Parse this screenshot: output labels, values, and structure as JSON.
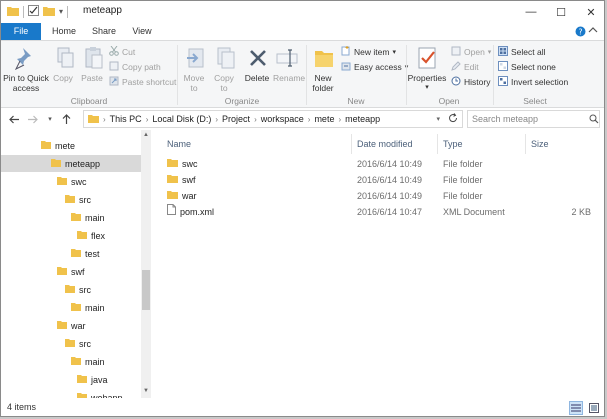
{
  "window": {
    "title": "meteapp",
    "minimize_glyph": "—",
    "maximize_glyph": "☐",
    "close_glyph": "✕"
  },
  "tabs": [
    {
      "label": "File"
    },
    {
      "label": "Home"
    },
    {
      "label": "Share"
    },
    {
      "label": "View"
    }
  ],
  "ribbon": {
    "clipboard": {
      "group_label": "Clipboard",
      "pin_label_1": "Pin to Quick",
      "pin_label_2": "access",
      "copy_label": "Copy",
      "paste_label": "Paste",
      "cut_label": "Cut",
      "copy_path_label": "Copy path",
      "paste_shortcut_label": "Paste shortcut"
    },
    "organize": {
      "group_label": "Organize",
      "move_to_1": "Move",
      "move_to_2": "to",
      "copy_to_1": "Copy",
      "copy_to_2": "to",
      "delete_label": "Delete",
      "rename_label": "Rename"
    },
    "new": {
      "group_label": "New",
      "new_folder_1": "New",
      "new_folder_2": "folder",
      "new_item_label": "New item",
      "easy_access_label": "Easy access"
    },
    "open": {
      "group_label": "Open",
      "properties_label": "Properties",
      "open_label": "Open",
      "edit_label": "Edit",
      "history_label": "History"
    },
    "select": {
      "group_label": "Select",
      "select_all_label": "Select all",
      "select_none_label": "Select none",
      "invert_selection_label": "Invert selection"
    }
  },
  "address": {
    "crumbs": [
      "This PC",
      "Local Disk (D:)",
      "Project",
      "workspace",
      "mete",
      "meteapp"
    ],
    "search_placeholder": "Search meteapp"
  },
  "nav_tree": [
    {
      "label": "mete",
      "depth": 0
    },
    {
      "label": "meteapp",
      "depth": 1,
      "selected": true
    },
    {
      "label": "swc",
      "depth": 2
    },
    {
      "label": "src",
      "depth": 3
    },
    {
      "label": "main",
      "depth": 4
    },
    {
      "label": "flex",
      "depth": 5
    },
    {
      "label": "test",
      "depth": 4
    },
    {
      "label": "swf",
      "depth": 2
    },
    {
      "label": "src",
      "depth": 3
    },
    {
      "label": "main",
      "depth": 4
    },
    {
      "label": "war",
      "depth": 2
    },
    {
      "label": "src",
      "depth": 3
    },
    {
      "label": "main",
      "depth": 4
    },
    {
      "label": "java",
      "depth": 5
    },
    {
      "label": "webapp",
      "depth": 5
    }
  ],
  "columns": {
    "name": "Name",
    "date_modified": "Date modified",
    "type": "Type",
    "size": "Size"
  },
  "files": [
    {
      "name": "swc",
      "date": "2016/6/14 10:49",
      "type": "File folder",
      "size": "",
      "kind": "folder"
    },
    {
      "name": "swf",
      "date": "2016/6/14 10:49",
      "type": "File folder",
      "size": "",
      "kind": "folder"
    },
    {
      "name": "war",
      "date": "2016/6/14 10:49",
      "type": "File folder",
      "size": "",
      "kind": "folder"
    },
    {
      "name": "pom.xml",
      "date": "2016/6/14 10:47",
      "type": "XML Document",
      "size": "2 KB",
      "kind": "file"
    }
  ],
  "status": {
    "item_count": "4 items"
  },
  "colors": {
    "accent": "#1979ca",
    "folder": "#f0c24b",
    "selected_row": "#d9d9d9"
  }
}
